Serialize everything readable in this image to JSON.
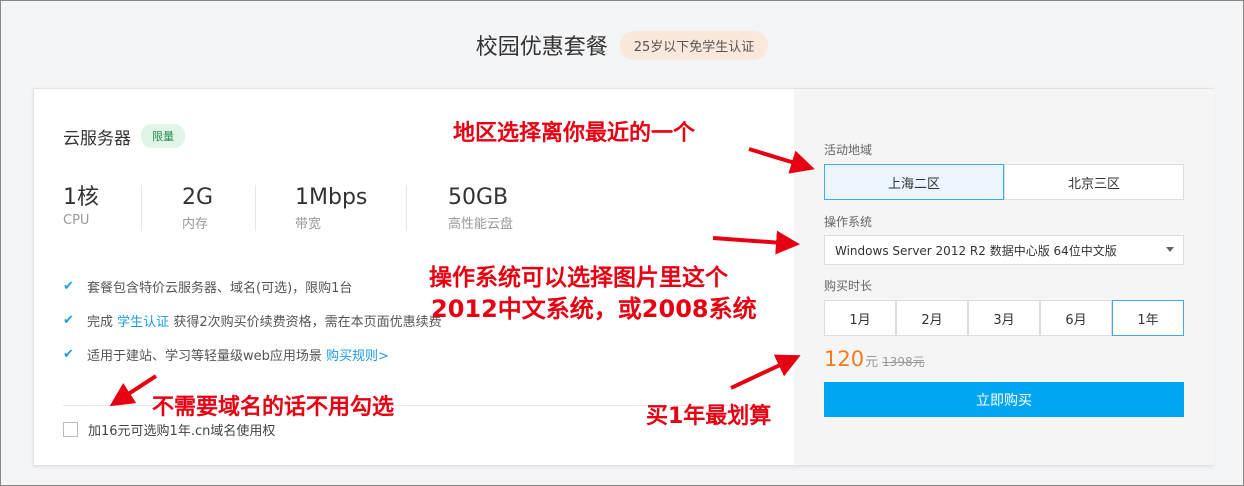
{
  "header": {
    "title": "校园优惠套餐",
    "badge": "25岁以下免学生认证"
  },
  "product": {
    "name": "云服务器",
    "badge": "限量"
  },
  "specs": [
    {
      "value": "1核",
      "label": "CPU"
    },
    {
      "value": "2G",
      "label": "内存"
    },
    {
      "value": "1Mbps",
      "label": "带宽"
    },
    {
      "value": "50GB",
      "label": "高性能云盘"
    }
  ],
  "features": {
    "f1": "套餐包含特价云服务器、域名(可选)，限购1台",
    "f2_pre": "完成",
    "f2_link": "学生认证",
    "f2_post": "获得2次购买价续费资格，需在本页面优惠续费",
    "f3_pre": "适用于建站、学习等轻量级web应用场景",
    "f3_link": "购买规则>"
  },
  "domain_option": {
    "label": "加16元可选购1年.cn域名使用权",
    "checked": false
  },
  "region": {
    "label": "活动地域",
    "options": [
      "上海二区",
      "北京三区"
    ],
    "selected": "上海二区"
  },
  "os": {
    "label": "操作系统",
    "value": "Windows Server 2012 R2 数据中心版 64位中文版"
  },
  "duration": {
    "label": "购买时长",
    "options": [
      "1月",
      "2月",
      "3月",
      "6月",
      "1年"
    ],
    "selected": "1年"
  },
  "price": {
    "current": "120",
    "unit": "元",
    "original": "1398元"
  },
  "buy_button": "立即购买",
  "annotations": {
    "region_tip": "地区选择离你最近的一个",
    "os_tip_line1": "操作系统可以选择图片里这个",
    "os_tip_line2": "2012中文系统，或2008系统",
    "domain_tip": "不需要域名的话不用勾选",
    "duration_tip": "买1年最划算"
  },
  "colors": {
    "accent": "#00a6f2",
    "price": "#f57a1f",
    "annotation": "#e60012"
  }
}
